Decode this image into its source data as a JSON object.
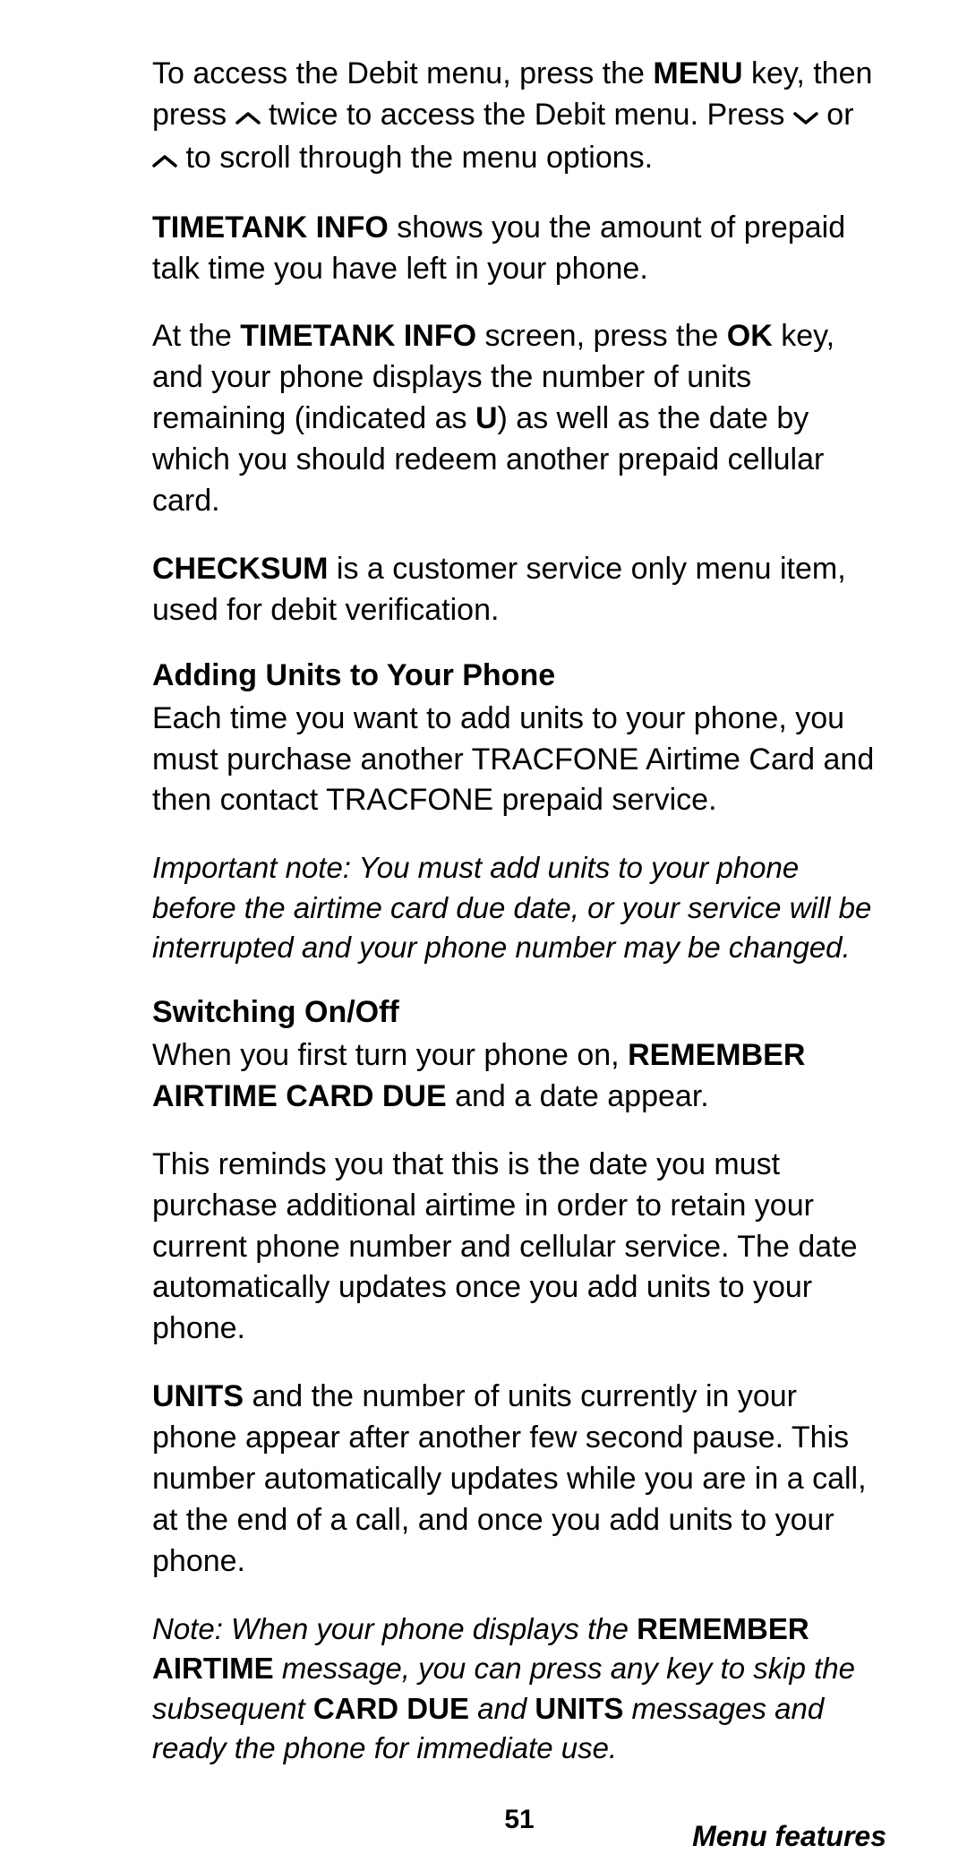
{
  "p1": {
    "a": "To access the Debit menu, press the ",
    "b": "MENU",
    "c": " key, then press ",
    "d": " twice to access the Debit menu. Press ",
    "e": " or ",
    "f": " to scroll through the menu options."
  },
  "p2": {
    "a": "TIMETANK INFO",
    "b": " shows you the amount of prepaid talk time you have left in your phone."
  },
  "p3": {
    "a": "At the ",
    "b": "TIMETANK INFO",
    "c": " screen, press the ",
    "d": "OK",
    "e": " key, and your phone displays the number of units remaining (indicated as ",
    "f": "U",
    "g": ") as well as the date by which you should redeem another prepaid cellular card."
  },
  "p4": {
    "a": "CHECKSUM",
    "b": " is a customer service only menu item, used for debit verification."
  },
  "h1": "Adding Units to Your Phone",
  "p5": "Each time you want to add units to your phone, you must purchase another TRACFONE Airtime Card and then contact TRACFONE prepaid service.",
  "note1": "Important note:  You must add units to your phone before the airtime card due date, or your service will be interrupted and your phone number may be changed.",
  "h2": "Switching On/Off",
  "p6": {
    "a": "When you first turn your phone on, ",
    "b": "REMEMBER AIRTIME CARD DUE",
    "c": " and a date appear."
  },
  "p7": "This reminds you that this is the date you must purchase additional airtime in order to retain your current phone number and cellular service. The date automatically updates once you add units to your phone.",
  "p8": {
    "a": "UNITS",
    "b": " and the number of units currently in your phone appear after another few second pause. This number automatically updates while you are in a call, at the end of a call, and once you add units to your phone."
  },
  "note2": {
    "a": "Note:  When your phone displays the ",
    "b": "REMEMBER AIRTIME",
    "c": " message, you can press any key to skip the subsequent ",
    "d": "CARD DUE",
    "e": " and ",
    "f": "UNITS",
    "g": " messages and ready the phone for immediate use."
  },
  "pageNumber": "51",
  "footer": "Menu features"
}
